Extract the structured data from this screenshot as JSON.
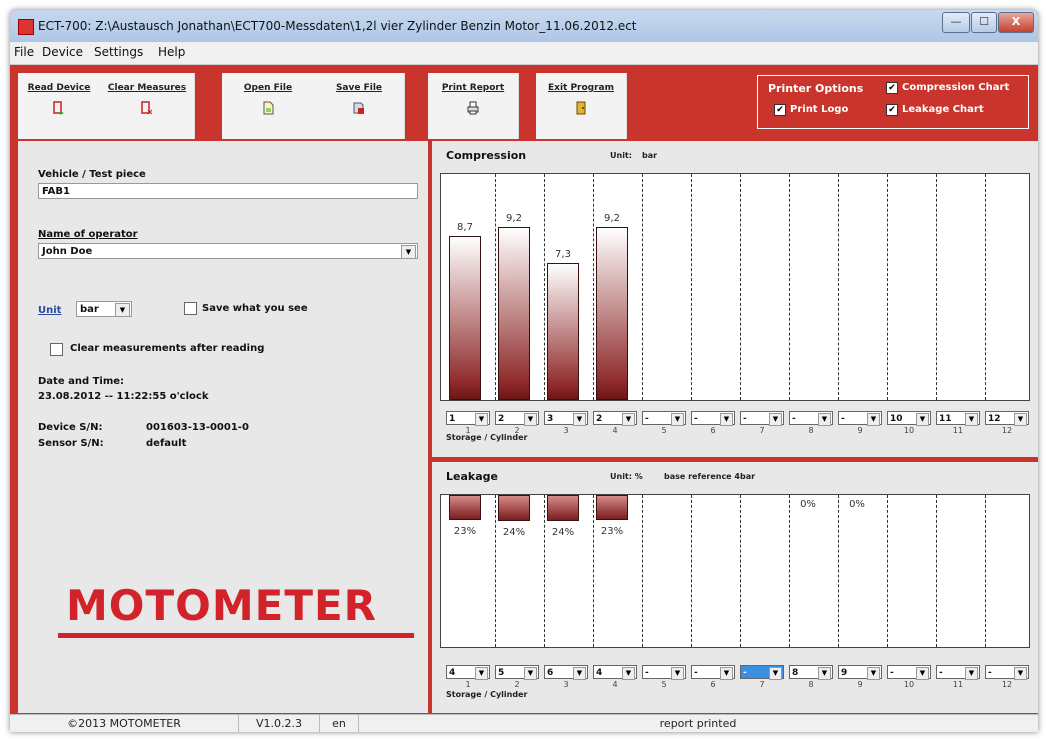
{
  "window": {
    "title": "ECT-700: Z:\\Austausch Jonathan\\ECT700-Messdaten\\1,2l vier Zylinder Benzin Motor_11.06.2012.ect",
    "minimize": "—",
    "maximize": "☐",
    "close": "X"
  },
  "menu": [
    "File",
    "Device",
    "Settings",
    "Help"
  ],
  "toolbar": {
    "read_device": "Read Device",
    "clear_measures": "Clear Measures",
    "open_file": "Open File",
    "save_file": "Save File",
    "print_report": "Print Report",
    "exit_program": "Exit Program"
  },
  "printer": {
    "title": "Printer Options",
    "print_logo": "Print Logo",
    "compression_chart": "Compression Chart",
    "leakage_chart": "Leakage Chart",
    "check": "✔"
  },
  "form": {
    "vehicle_label": "Vehicle / Test piece",
    "vehicle_value": "FAB1",
    "operator_label": "Name of operator",
    "operator_value": "John Doe",
    "unit_label": "Unit",
    "unit_value": "bar",
    "save_what_you_see": "Save what you see",
    "clear_after_reading": "Clear measurements after reading",
    "date_label": "Date and Time:",
    "date_value": "23.08.2012 -- 11:22:55 o'clock",
    "device_sn_label": "Device S/N:",
    "device_sn_value": "001603-13-0001-0",
    "sensor_sn_label": "Sensor S/N:",
    "sensor_sn_value": "default",
    "dropdown_arrow": "▼"
  },
  "logo": "MOTOMETER",
  "compression": {
    "title": "Compression",
    "unit_label": "Unit:",
    "unit_value": "bar",
    "values": [
      8.7,
      9.2,
      7.3,
      9.2
    ],
    "labels": [
      "8,7",
      "9,2",
      "7,3",
      "9,2"
    ],
    "max": 10,
    "selectors": [
      "1",
      "2",
      "3",
      "2",
      "-",
      "-",
      "-",
      "-",
      "-",
      "10",
      "11",
      "12"
    ],
    "axis": [
      "1",
      "2",
      "3",
      "4",
      "5",
      "6",
      "7",
      "8",
      "9",
      "10",
      "11",
      "12"
    ],
    "storage_label": "Storage / Cylinder"
  },
  "leakage": {
    "title": "Leakage",
    "unit_label": "Unit: %",
    "unit_value": "base reference 4bar",
    "values": [
      23,
      24,
      24,
      23
    ],
    "labels": [
      "23%",
      "24%",
      "24%",
      "23%"
    ],
    "extra_labels": [
      {
        "col": 8,
        "text": "0%"
      },
      {
        "col": 9,
        "text": "0%"
      }
    ],
    "selectors": [
      "4",
      "5",
      "6",
      "4",
      "-",
      "-",
      "-",
      "8",
      "9",
      "-",
      "-",
      "-"
    ],
    "highlight_index": 6,
    "axis": [
      "1",
      "2",
      "3",
      "4",
      "5",
      "6",
      "7",
      "8",
      "9",
      "10",
      "11",
      "12"
    ],
    "storage_label": "Storage / Cylinder"
  },
  "status": {
    "copyright": "©2013 MOTOMETER",
    "version": "V1.0.2.3",
    "lang": "en",
    "message": "report printed"
  },
  "colors": {
    "accent": "#c9352c",
    "bar": "#8f2b2b"
  }
}
